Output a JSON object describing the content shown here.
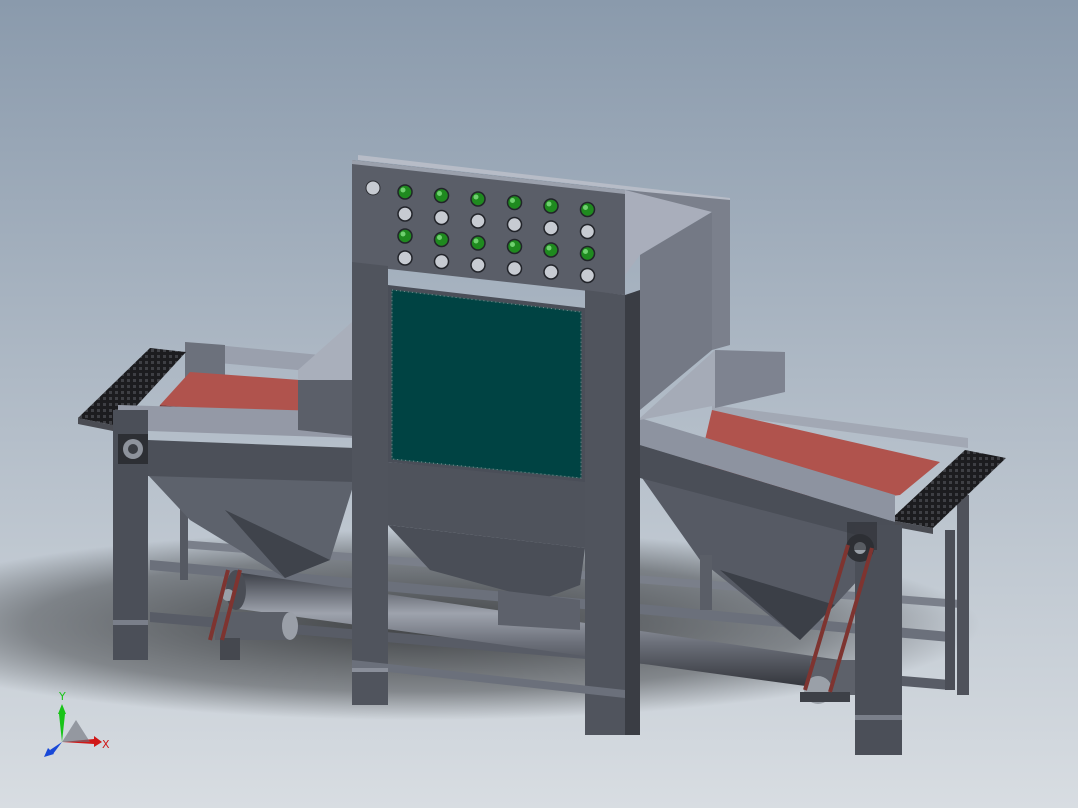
{
  "viewport": {
    "background_top": "#8a9aac",
    "background_bottom": "#d8dde2"
  },
  "triad": {
    "y_label": "Y",
    "x_label": "X",
    "y_color": "#18c418",
    "x_color": "#d01818",
    "z_color": "#1848d8"
  },
  "colors": {
    "steel_light": "#8e95a3",
    "steel_mid": "#5c616c",
    "steel_dark": "#3c3f47",
    "steel_deep": "#2b2d33",
    "belt": "#b0534d",
    "belt_dark": "#7e3430",
    "window_glass": "#004343",
    "button_green": "#1f8a1f",
    "button_grey": "#c7cbd2",
    "mesh": "#1c1c1f"
  },
  "panel": {
    "button_rows": 4,
    "button_columns": 6
  }
}
